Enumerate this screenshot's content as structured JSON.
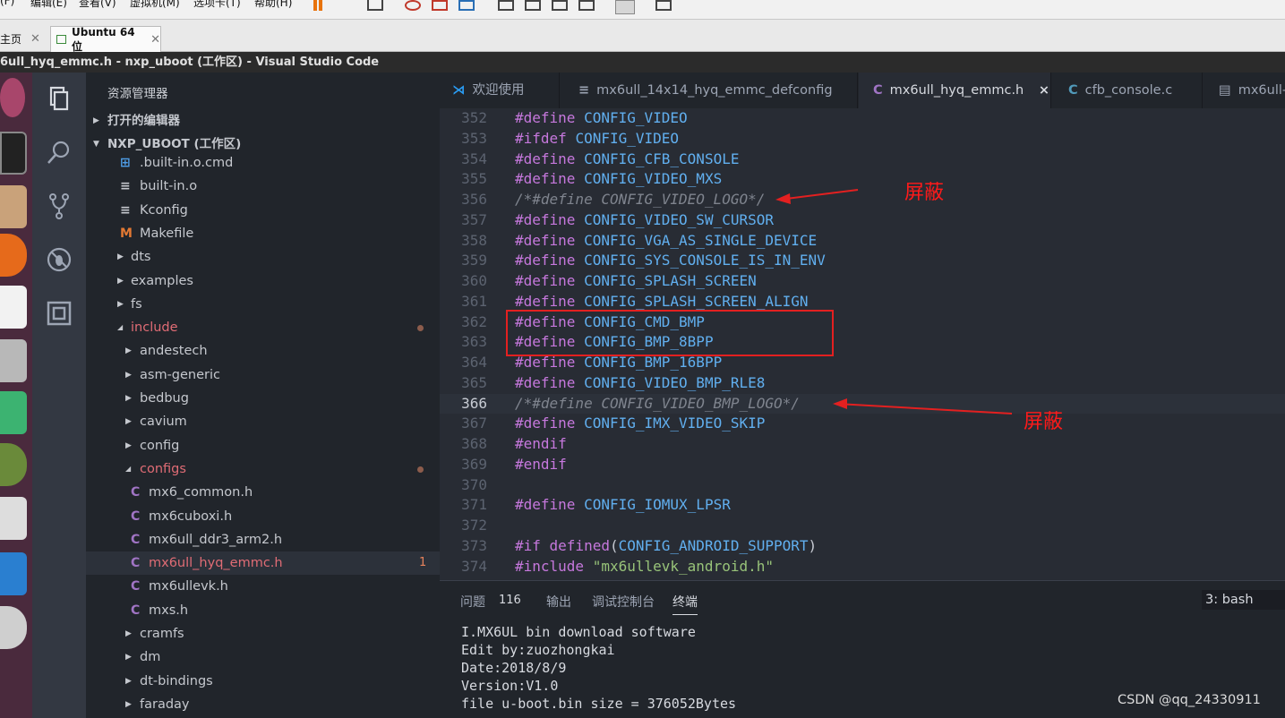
{
  "vm": {
    "menus": [
      "(F)",
      "编辑(E)",
      "查看(V)",
      "虚拟机(M)",
      "选项卡(T)",
      "帮助(H)"
    ],
    "tabs": [
      {
        "label": "主页"
      },
      {
        "label": "Ubuntu 64 位"
      }
    ]
  },
  "window_title": "6ull_hyq_emmc.h - nxp_uboot (工作区) - Visual Studio Code",
  "sidebar": {
    "title": "资源管理器",
    "open_editors": "打开的编辑器",
    "workspace": "NXP_UBOOT (工作区)",
    "items": [
      {
        "label": ".built-in.o.cmd",
        "icon": "windows-icon"
      },
      {
        "label": "built-in.o",
        "icon": "file-lines-icon"
      },
      {
        "label": "Kconfig",
        "icon": "file-lines-icon"
      },
      {
        "label": "Makefile",
        "icon": "makefile-m-icon"
      },
      {
        "label": "dts",
        "icon": "chevron-right-icon"
      },
      {
        "label": "examples",
        "icon": "chevron-right-icon"
      },
      {
        "label": "fs",
        "icon": "chevron-right-icon"
      },
      {
        "label": "include",
        "icon": "chevron-down-icon"
      },
      {
        "label": "andestech",
        "icon": "chevron-right-icon"
      },
      {
        "label": "asm-generic",
        "icon": "chevron-right-icon"
      },
      {
        "label": "bedbug",
        "icon": "chevron-right-icon"
      },
      {
        "label": "cavium",
        "icon": "chevron-right-icon"
      },
      {
        "label": "config",
        "icon": "chevron-right-icon"
      },
      {
        "label": "configs",
        "icon": "chevron-down-icon"
      },
      {
        "label": "mx6_common.h",
        "icon": "c-file-icon"
      },
      {
        "label": "mx6cuboxi.h",
        "icon": "c-file-icon"
      },
      {
        "label": "mx6ull_ddr3_arm2.h",
        "icon": "c-file-icon"
      },
      {
        "label": "mx6ull_hyq_emmc.h",
        "icon": "c-file-icon",
        "badge": "1"
      },
      {
        "label": "mx6ullevk.h",
        "icon": "c-file-icon"
      },
      {
        "label": "mxs.h",
        "icon": "c-file-icon"
      },
      {
        "label": "cramfs",
        "icon": "chevron-right-icon"
      },
      {
        "label": "dm",
        "icon": "chevron-right-icon"
      },
      {
        "label": "dt-bindings",
        "icon": "chevron-right-icon"
      },
      {
        "label": "faraday",
        "icon": "chevron-right-icon"
      }
    ]
  },
  "editor_tabs": [
    {
      "label": "欢迎使用",
      "icon": "vscode-icon"
    },
    {
      "label": "mx6ull_14x14_hyq_emmc_defconfig",
      "icon": "lines-icon"
    },
    {
      "label": "mx6ull_hyq_emmc.h",
      "icon": "c-file-icon",
      "close": "×"
    },
    {
      "label": "cfb_console.c",
      "icon": "c-file-icon"
    },
    {
      "label": "mx6ull-",
      "icon": "document-icon"
    }
  ],
  "code": {
    "lines": [
      {
        "n": "352",
        "kw": "#define",
        "mc": "CONFIG_VIDEO"
      },
      {
        "n": "353",
        "kw": "#ifdef",
        "mc": "CONFIG_VIDEO"
      },
      {
        "n": "354",
        "kw": "#define",
        "mc": "CONFIG_CFB_CONSOLE"
      },
      {
        "n": "355",
        "kw": "#define",
        "mc": "CONFIG_VIDEO_MXS"
      },
      {
        "n": "356",
        "comment": "/*#define CONFIG_VIDEO_LOGO*/"
      },
      {
        "n": "357",
        "kw": "#define",
        "mc": "CONFIG_VIDEO_SW_CURSOR"
      },
      {
        "n": "358",
        "kw": "#define",
        "mc": "CONFIG_VGA_AS_SINGLE_DEVICE"
      },
      {
        "n": "359",
        "kw": "#define",
        "mc": "CONFIG_SYS_CONSOLE_IS_IN_ENV"
      },
      {
        "n": "360",
        "kw": "#define",
        "mc": "CONFIG_SPLASH_SCREEN"
      },
      {
        "n": "361",
        "kw": "#define",
        "mc": "CONFIG_SPLASH_SCREEN_ALIGN"
      },
      {
        "n": "362",
        "kw": "#define",
        "mc": "CONFIG_CMD_BMP"
      },
      {
        "n": "363",
        "kw": "#define",
        "mc": "CONFIG_BMP_8BPP"
      },
      {
        "n": "364",
        "kw": "#define",
        "mc": "CONFIG_BMP_16BPP"
      },
      {
        "n": "365",
        "kw": "#define",
        "mc": "CONFIG_VIDEO_BMP_RLE8"
      },
      {
        "n": "366",
        "comment": "/*#define CONFIG_VIDEO_BMP_LOGO*/"
      },
      {
        "n": "367",
        "kw": "#define",
        "mc": "CONFIG_IMX_VIDEO_SKIP"
      },
      {
        "n": "368",
        "kw": "#endif"
      },
      {
        "n": "369",
        "kw": "#endif"
      },
      {
        "n": "370"
      },
      {
        "n": "371",
        "kw": "#define",
        "mc": "CONFIG_IOMUX_LPSR"
      },
      {
        "n": "372"
      },
      {
        "n": "373",
        "kw": "#if defined",
        "p1": "(",
        "mc": "CONFIG_ANDROID_SUPPORT",
        "p2": ")"
      },
      {
        "n": "374",
        "kw": "#include",
        "str": "\"mx6ullevk_android.h\""
      }
    ],
    "annotation_1": "屏蔽",
    "annotation_2": "屏蔽"
  },
  "panel": {
    "tabs": [
      "问题",
      "输出",
      "调试控制台",
      "终端"
    ],
    "problem_count": "116",
    "shell": "3: bash",
    "terminal_lines": [
      "I.MX6UL bin download software",
      "Edit by:zuozhongkai",
      "Date:2018/8/9",
      "Version:V1.0",
      "file u-boot.bin size = 376052Bytes"
    ]
  },
  "watermark": "CSDN @qq_24330911",
  "colors": {
    "accent_red": "#ff1a1a",
    "keyword": "#c678dd",
    "macro": "#61afef",
    "comment": "#7f848e",
    "string": "#98c379"
  }
}
